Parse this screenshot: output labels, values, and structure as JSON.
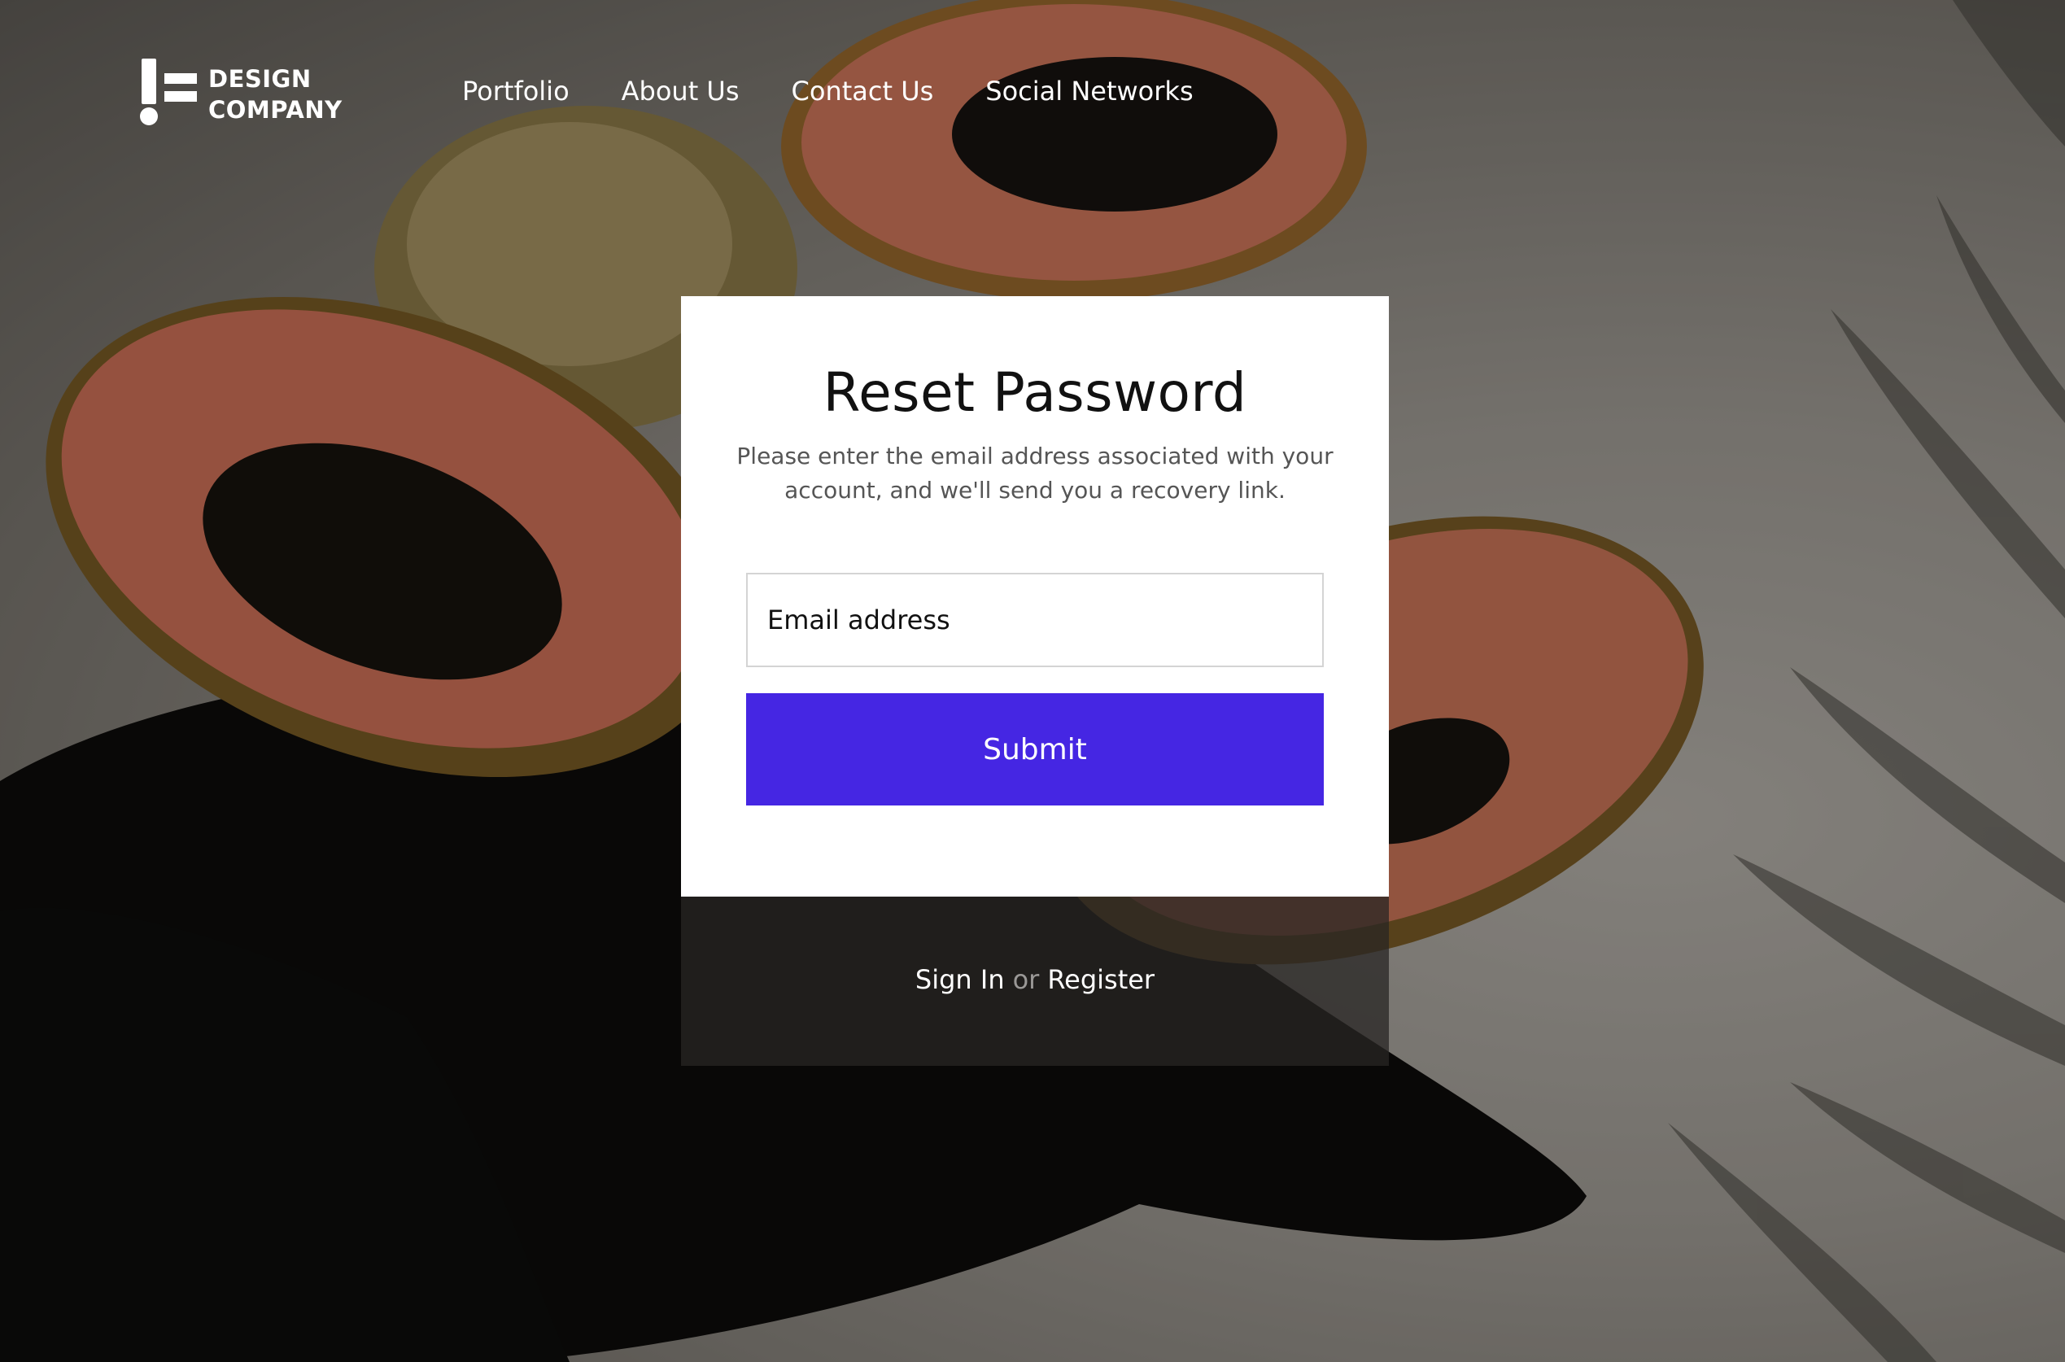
{
  "logo": {
    "line1": "DESIGN",
    "line2": "COMPANY"
  },
  "nav": {
    "items": [
      {
        "label": "Portfolio"
      },
      {
        "label": "About Us"
      },
      {
        "label": "Contact Us"
      },
      {
        "label": "Social Networks"
      }
    ]
  },
  "card": {
    "title": "Reset Password",
    "description": "Please enter the email address associated with your account, and we'll send you a recovery link.",
    "email_placeholder": "Email address",
    "email_value": "",
    "submit_label": "Submit"
  },
  "footer": {
    "sign_in": "Sign In",
    "or": "or",
    "register": "Register"
  },
  "colors": {
    "accent": "#4526e3",
    "card_bg": "#ffffff",
    "papaya_flesh": "#e8835f"
  }
}
